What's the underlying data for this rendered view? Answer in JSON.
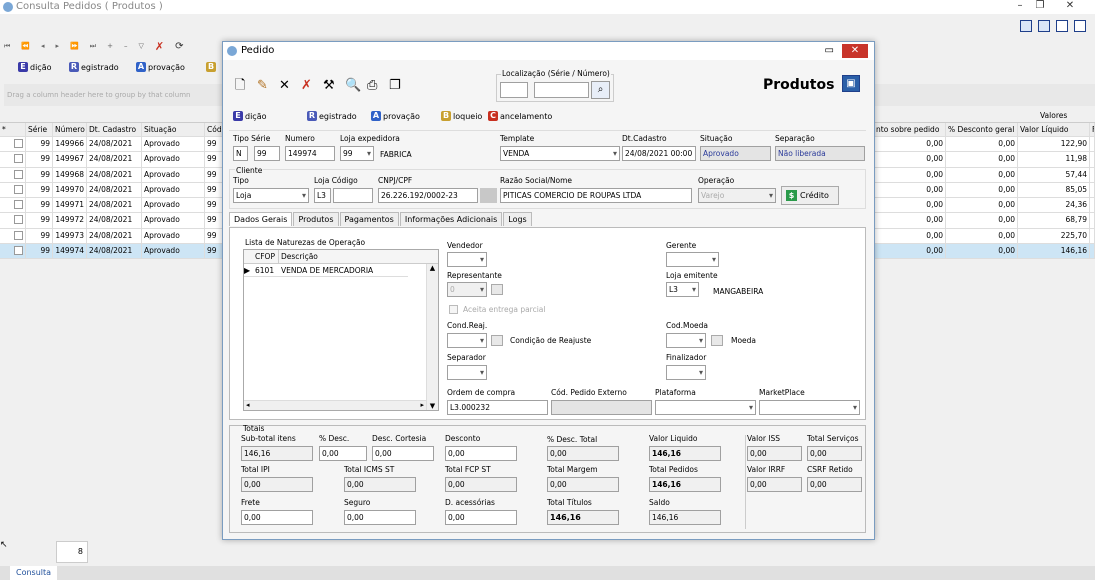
{
  "bg": {
    "title": "Consulta Pedidos ( Produtos )",
    "actions": [
      "dição",
      "egistrado",
      "provação"
    ],
    "action_letters": [
      "E",
      "R",
      "A",
      "B"
    ],
    "group_hint": "Drag a column header here to group by that column",
    "valores": "Valores",
    "left_headers": [
      "Série",
      "Número",
      "Dt. Cadastro",
      "Situação",
      "Cód"
    ],
    "right_headers": [
      "nto sobre pedido",
      "% Desconto geral",
      "Valor Líquido",
      "F"
    ],
    "rows": [
      {
        "serie": "99",
        "num": "149966",
        "dt": "24/08/2021",
        "sit": "Aprovado",
        "cod": "99",
        "a": "0,00",
        "b": "0,00",
        "v": "122,90"
      },
      {
        "serie": "99",
        "num": "149967",
        "dt": "24/08/2021",
        "sit": "Aprovado",
        "cod": "99",
        "a": "0,00",
        "b": "0,00",
        "v": "11,98"
      },
      {
        "serie": "99",
        "num": "149968",
        "dt": "24/08/2021",
        "sit": "Aprovado",
        "cod": "99",
        "a": "0,00",
        "b": "0,00",
        "v": "57,44"
      },
      {
        "serie": "99",
        "num": "149970",
        "dt": "24/08/2021",
        "sit": "Aprovado",
        "cod": "99",
        "a": "0,00",
        "b": "0,00",
        "v": "85,05"
      },
      {
        "serie": "99",
        "num": "149971",
        "dt": "24/08/2021",
        "sit": "Aprovado",
        "cod": "99",
        "a": "0,00",
        "b": "0,00",
        "v": "24,36"
      },
      {
        "serie": "99",
        "num": "149972",
        "dt": "24/08/2021",
        "sit": "Aprovado",
        "cod": "99",
        "a": "0,00",
        "b": "0,00",
        "v": "68,79"
      },
      {
        "serie": "99",
        "num": "149973",
        "dt": "24/08/2021",
        "sit": "Aprovado",
        "cod": "99",
        "a": "0,00",
        "b": "0,00",
        "v": "225,70"
      },
      {
        "serie": "99",
        "num": "149974",
        "dt": "24/08/2021",
        "sit": "Aprovado",
        "cod": "99",
        "a": "0,00",
        "b": "0,00",
        "v": "146,16"
      }
    ],
    "count": "8",
    "tab": "Consulta"
  },
  "dlg": {
    "title": "Pedido",
    "loc_label": "Localização (Série / Número)",
    "heading": "Produtos",
    "actions": [
      "dição",
      "egistrado",
      "provação",
      "loqueio",
      "ancelamento"
    ],
    "action_letters": [
      "E",
      "R",
      "A",
      "B",
      "C"
    ],
    "tipo_serie": "Tipo Série",
    "tipo": "N",
    "serie": "99",
    "numero_lbl": "Numero",
    "numero": "149974",
    "loja_exp_lbl": "Loja expedidora",
    "loja_exp": "99",
    "loja_exp_name": "FABRICA",
    "template_lbl": "Template",
    "template": "VENDA",
    "dtcad_lbl": "Dt.Cadastro",
    "dtcad": "24/08/2021 00:00",
    "sit_lbl": "Situação",
    "sit": "Aprovado",
    "sep_lbl": "Separação",
    "sep": "Não liberada",
    "cliente": "Cliente",
    "ctipo_lbl": "Tipo",
    "ctipo": "Loja",
    "lojacod_lbl": "Loja Código",
    "lojacod": "L3",
    "cnpj_lbl": "CNPJ/CPF",
    "cnpj": "26.226.192/0002-23",
    "razao_lbl": "Razão Social/Nome",
    "razao": "PITICAS COMERCIO DE ROUPAS LTDA",
    "oper_lbl": "Operação",
    "oper": "Varejo",
    "credito": "Crédito",
    "tabs": [
      "Dados Gerais",
      "Produtos",
      "Pagamentos",
      "Informações Adicionais",
      "Logs"
    ],
    "nat_title": "Lista de Naturezas de Operação",
    "nat_h1": "CFOP",
    "nat_h2": "Descrição",
    "nat_cfop": "6101",
    "nat_desc": "VENDA DE MERCADORIA",
    "vendedor": "Vendedor",
    "gerente": "Gerente",
    "representante": "Representante",
    "rep_val": "0",
    "loja_em": "Loja emitente",
    "loja_em_val": "L3",
    "loja_em_name": "MANGABEIRA",
    "aceita": "Aceita entrega parcial",
    "cond_reaj": "Cond.Reaj.",
    "cond_reaj_name": "Condição de Reajuste",
    "cod_moeda": "Cod.Moeda",
    "moeda": "Moeda",
    "separador": "Separador",
    "finalizador": "Finalizador",
    "ordem": "Ordem de compra",
    "ordem_val": "L3.000232",
    "cod_ext": "Cód. Pedido Externo",
    "plataforma": "Plataforma",
    "marketplace": "MarketPlace",
    "totais": "Totais",
    "t": {
      "subtotal_l": "Sub-total itens",
      "subtotal": "146,16",
      "pdesc_l": "% Desc.",
      "pdesc": "0,00",
      "desccort_l": "Desc. Cortesia",
      "desccort": "0,00",
      "desconto_l": "Desconto",
      "desconto": "0,00",
      "pdesctot_l": "% Desc. Total",
      "pdesctot": "0,00",
      "vliq_l": "Valor Liquido",
      "vliq": "146,16",
      "viss_l": "Valor ISS",
      "viss": "0,00",
      "tserv_l": "Total Serviços",
      "tserv": "0,00",
      "tipi_l": "Total IPI",
      "tipi": "0,00",
      "ticms_l": "Total ICMS ST",
      "ticms": "0,00",
      "tfcp_l": "Total FCP ST",
      "tfcp": "0,00",
      "tmarg_l": "Total Margem",
      "tmarg": "0,00",
      "tped_l": "Total Pedidos",
      "tped": "146,16",
      "virrf_l": "Valor IRRF",
      "virrf": "0,00",
      "csrf_l": "CSRF Retido",
      "csrf": "0,00",
      "frete_l": "Frete",
      "frete": "0,00",
      "seguro_l": "Seguro",
      "seguro": "0,00",
      "dacess_l": "D. acessórias",
      "dacess": "0,00",
      "ttit_l": "Total Títulos",
      "ttit": "146,16",
      "saldo_l": "Saldo",
      "saldo": "146,16"
    }
  }
}
